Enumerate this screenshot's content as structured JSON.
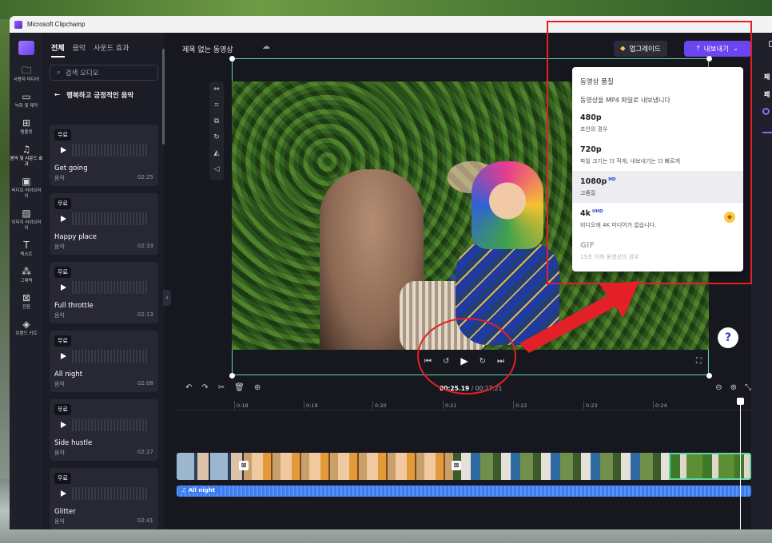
{
  "window": {
    "title": "Microsoft Clipchamp"
  },
  "rail": {
    "items": [
      {
        "icon": "folder-icon",
        "glyph": "🗀",
        "label": "사용자 미디어"
      },
      {
        "icon": "camera-icon",
        "glyph": "▭",
        "label": "녹화 및 제작"
      },
      {
        "icon": "templates-icon",
        "glyph": "⊞",
        "label": "템플릿"
      },
      {
        "icon": "music-icon",
        "glyph": "♫",
        "label": "음악 및 사운드 효과"
      },
      {
        "icon": "video-library-icon",
        "glyph": "▣",
        "label": "비디오 라이브러리"
      },
      {
        "icon": "image-library-icon",
        "glyph": "▨",
        "label": "이미지 라이브러리"
      },
      {
        "icon": "text-icon",
        "glyph": "T",
        "label": "텍스트"
      },
      {
        "icon": "graphics-icon",
        "glyph": "⁂",
        "label": "그래픽"
      },
      {
        "icon": "transitions-icon",
        "glyph": "⊠",
        "label": "전환"
      },
      {
        "icon": "brand-kit-icon",
        "glyph": "◈",
        "label": "브랜드 키트"
      }
    ]
  },
  "library": {
    "tabs": [
      "전체",
      "음악",
      "사운드 효과"
    ],
    "search_placeholder": "검색 오디오",
    "category_title": "행복하고 긍정적인 음악",
    "tracks": [
      {
        "badge": "무료",
        "name": "Get going",
        "type": "음악",
        "duration": "02:25"
      },
      {
        "badge": "무료",
        "name": "Happy place",
        "type": "음악",
        "duration": "02:33"
      },
      {
        "badge": "무료",
        "name": "Full throttle",
        "type": "음악",
        "duration": "02:13"
      },
      {
        "badge": "무료",
        "name": "All night",
        "type": "음악",
        "duration": "02:08"
      },
      {
        "badge": "무료",
        "name": "Side hustle",
        "type": "음악",
        "duration": "02:27"
      },
      {
        "badge": "무료",
        "name": "Glitter",
        "type": "음악",
        "duration": "02:41"
      }
    ]
  },
  "header": {
    "project_title": "제목 없는 동영상",
    "upgrade_label": "업그레이드",
    "export_label": "내보내기"
  },
  "playback": {
    "current_time": "00:25.19",
    "total_time": "/ 00:27.21"
  },
  "ruler": {
    "ticks": [
      "0:18",
      "0:19",
      "0:20",
      "0:21",
      "0:22",
      "0:23",
      "0:24"
    ]
  },
  "audio_track": {
    "label": "All night"
  },
  "props_panel": {
    "label_1": "페",
    "label_2": "페"
  },
  "help": {
    "label": "?"
  },
  "export_menu": {
    "header": "동영상 품질",
    "description": "동영상을 MP4 파일로 내보냅니다",
    "options": [
      {
        "quality": "480p",
        "tag": "",
        "subtitle": "초안의 경우",
        "state": "normal"
      },
      {
        "quality": "720p",
        "tag": "",
        "subtitle": "파일 크기는 더 작게, 내보내기는 더 빠르게",
        "state": "normal"
      },
      {
        "quality": "1080p",
        "tag": "HD",
        "subtitle": "고품질",
        "state": "selected"
      },
      {
        "quality": "4k",
        "tag": "UHD",
        "subtitle": "비디오에 4K 미디어가 없습니다.",
        "state": "premium"
      },
      {
        "quality": "GIF",
        "tag": "",
        "subtitle": "15초 이하 동영상의 경우",
        "state": "disabled"
      }
    ]
  },
  "annotation_color": "#e32027",
  "accent_color": "#6b45f0"
}
